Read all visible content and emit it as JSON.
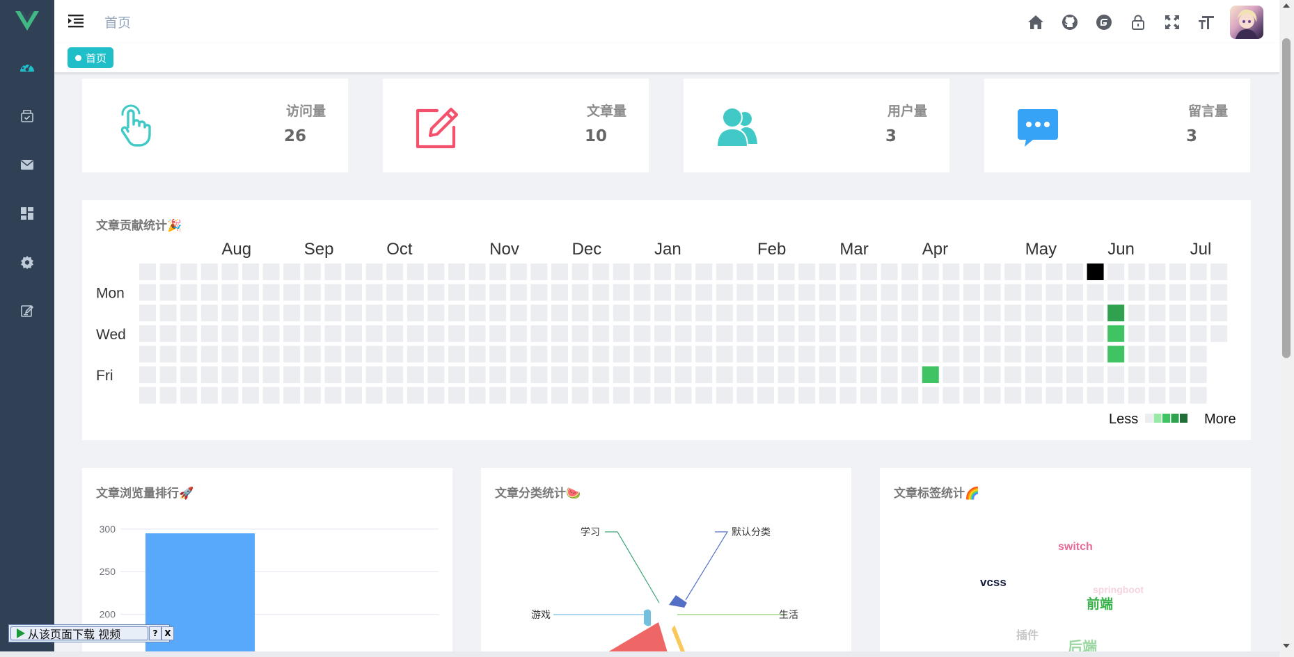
{
  "header": {
    "breadcrumb": "首页",
    "icons": [
      "home-icon",
      "github-icon",
      "gitee-icon",
      "lock-icon",
      "fullscreen-icon",
      "font-size-icon"
    ]
  },
  "tags": {
    "active_tag": "首页"
  },
  "stats": [
    {
      "label": "访问量",
      "value": "26",
      "icon": "pointer-hand-icon",
      "color": "#40c9c6"
    },
    {
      "label": "文章量",
      "value": "10",
      "icon": "edit-icon",
      "color": "#f4516c"
    },
    {
      "label": "用户量",
      "value": "3",
      "icon": "users-icon",
      "color": "#40c9c6"
    },
    {
      "label": "留言量",
      "value": "3",
      "icon": "message-icon",
      "color": "#36a3f7"
    }
  ],
  "heatmap": {
    "title": "文章贡献统计🎉",
    "months": [
      "Aug",
      "Sep",
      "Oct",
      "Nov",
      "Dec",
      "Jan",
      "Feb",
      "Mar",
      "Apr",
      "May",
      "Jun",
      "Jul"
    ],
    "month_weeks": [
      4,
      8,
      12,
      17,
      21,
      25,
      30,
      34,
      38,
      43,
      47,
      51
    ],
    "days": [
      "Mon",
      "Wed",
      "Fri"
    ],
    "weeks": 53,
    "legend_less": "Less",
    "legend_more": "More",
    "highlights": [
      {
        "week": 46,
        "day": 0,
        "level": "selected"
      },
      {
        "week": 47,
        "day": 2,
        "level": 3
      },
      {
        "week": 47,
        "day": 3,
        "level": 2
      },
      {
        "week": 47,
        "day": 4,
        "level": 2
      },
      {
        "week": 38,
        "day": 5,
        "level": 2
      }
    ],
    "colors": {
      "empty": "#ebedf0",
      "1": "#9be9a8",
      "2": "#40c463",
      "3": "#30a14e",
      "4": "#216e39",
      "selected": "#000000"
    }
  },
  "views_panel": {
    "title": "文章浏览量排行🚀",
    "chart_data": {
      "type": "bar",
      "yticks": [
        "300",
        "250",
        "200"
      ],
      "ylim": [
        200,
        300
      ],
      "values": [
        295
      ],
      "color": "#58a8fc"
    }
  },
  "category_panel": {
    "title": "文章分类统计🍉",
    "chart_data": {
      "type": "pie",
      "labels": [
        "学习",
        "默认分类",
        "游戏",
        "生活"
      ],
      "colors": {
        "学习": "#3ba272",
        "默认分类": "#5470c6",
        "游戏": "#73c0de",
        "生活": "#91cc75"
      }
    }
  },
  "tags_panel": {
    "title": "文章标签统计🌈",
    "words": [
      {
        "text": "switch",
        "color": "#e86a9a"
      },
      {
        "text": "vcss",
        "color": "#141a3c"
      },
      {
        "text": "springboot",
        "color": "#f6d3dd"
      },
      {
        "text": "前端",
        "color": "#39b24a"
      },
      {
        "text": "插件",
        "color": "#c8c8c8"
      },
      {
        "text": "后端",
        "color": "#9bd7a0"
      }
    ]
  },
  "download_bar": {
    "label": "从该页面下载 视频",
    "help": "?",
    "close": "X"
  }
}
